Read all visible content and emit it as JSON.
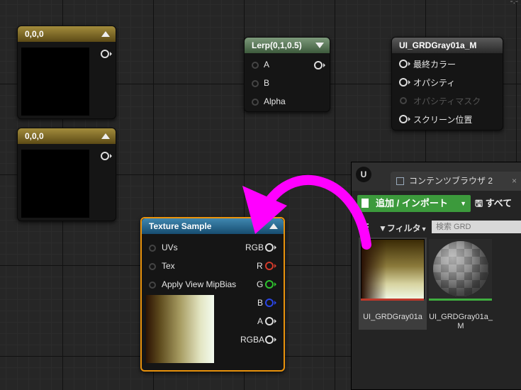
{
  "corner": {
    "text": "-.-"
  },
  "nodes": {
    "const1": {
      "title": "0,0,0"
    },
    "const2": {
      "title": "0,0,0"
    },
    "lerp": {
      "title": "Lerp(0,1,0.5)",
      "inputs": [
        "A",
        "B",
        "Alpha"
      ]
    },
    "material": {
      "title": "UI_GRDGray01a_M",
      "pins": [
        "最終カラー",
        "オパシティ",
        "オパシティマスク",
        "スクリーン位置"
      ]
    },
    "texture_sample": {
      "title": "Texture Sample",
      "inputs": [
        "UVs",
        "Tex",
        "Apply View MipBias"
      ],
      "outputs": [
        "RGB",
        "R",
        "G",
        "B",
        "A",
        "RGBA"
      ]
    }
  },
  "pin_colors": {
    "R": "#d23a2a",
    "G": "#2ec22e",
    "B": "#2a45e6",
    "default": "#dddddd"
  },
  "arrow": {
    "color": "#ff00ff",
    "from": "content-browser-asset",
    "to": "texture-sample-node"
  },
  "content_browser": {
    "logo": "U",
    "tab_label": "コンテンツブラウザ 2",
    "tab_close": "×",
    "add_import_label": "追加 / インポート",
    "save_all_label": "すべて",
    "filter_label": "フィルタ",
    "search_placeholder": "検索 GRD",
    "assets": [
      {
        "name": "UI_GRDGray01a",
        "type": "texture",
        "bar_color": "#c0392b",
        "selected": true
      },
      {
        "name": "UI_GRDGray01a_M",
        "type": "material",
        "bar_color": "#3fae3f",
        "selected": false
      }
    ]
  }
}
